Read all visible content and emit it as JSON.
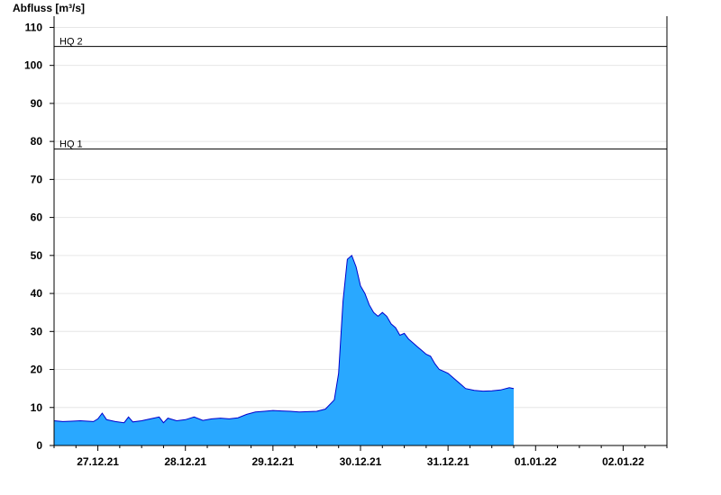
{
  "chart_data": {
    "type": "area",
    "ylabel": "Abfluss [m³/s]",
    "ylim": [
      0,
      112
    ],
    "yticks": [
      0,
      10,
      20,
      30,
      40,
      50,
      60,
      70,
      80,
      90,
      100,
      110
    ],
    "x_range_days": [
      26.5,
      33.5
    ],
    "xticks": [
      {
        "day": 27,
        "label": "27.12.21"
      },
      {
        "day": 28,
        "label": "28.12.21"
      },
      {
        "day": 29,
        "label": "29.12.21"
      },
      {
        "day": 30,
        "label": "30.12.21"
      },
      {
        "day": 31,
        "label": "31.12.21"
      },
      {
        "day": 32,
        "label": "01.01.22"
      },
      {
        "day": 33,
        "label": "02.01.22"
      }
    ],
    "grid": true,
    "thresholds": [
      {
        "name": "HQ 2",
        "value": 105
      },
      {
        "name": "HQ 1",
        "value": 78
      }
    ],
    "colors": {
      "fill": "#29a8ff",
      "line": "#0000cc",
      "grid": "#e6e6e6",
      "threshold": "#000000"
    },
    "series": [
      {
        "x": [
          26.5,
          26.6,
          26.7,
          26.8,
          26.95,
          27.0,
          27.05,
          27.1,
          27.2,
          27.3,
          27.35,
          27.4,
          27.5,
          27.6,
          27.7,
          27.75,
          27.8,
          27.9,
          28.0,
          28.1,
          28.2,
          28.3,
          28.4,
          28.5,
          28.6,
          28.7,
          28.8,
          28.9,
          29.0,
          29.1,
          29.2,
          29.3,
          29.4,
          29.5,
          29.6,
          29.7,
          29.75,
          29.8,
          29.85,
          29.9,
          29.95,
          30.0,
          30.05,
          30.1,
          30.15,
          30.2,
          30.25,
          30.3,
          30.35,
          30.4,
          30.45,
          30.5,
          30.55,
          30.6,
          30.65,
          30.7,
          30.75,
          30.8,
          30.85,
          30.9,
          30.95,
          31.0,
          31.05,
          31.1,
          31.15,
          31.2,
          31.3,
          31.4,
          31.5,
          31.6,
          31.7,
          31.75
        ],
        "y": [
          6.5,
          6.3,
          6.4,
          6.5,
          6.3,
          7.0,
          8.5,
          6.8,
          6.3,
          6.0,
          7.5,
          6.2,
          6.5,
          7.0,
          7.5,
          6.0,
          7.2,
          6.5,
          6.8,
          7.5,
          6.6,
          7.0,
          7.2,
          7.0,
          7.3,
          8.2,
          8.8,
          9.0,
          9.2,
          9.1,
          9.0,
          8.8,
          8.9,
          9.0,
          9.6,
          12.0,
          19.0,
          38.0,
          49.0,
          50.0,
          47.0,
          42.0,
          40.0,
          37.0,
          35.0,
          34.0,
          35.0,
          34.0,
          32.0,
          31.0,
          29.0,
          29.5,
          28.0,
          27.0,
          26.0,
          25.0,
          24.0,
          23.5,
          21.5,
          20.0,
          19.5,
          19.0,
          18.0,
          17.0,
          16.0,
          15.0,
          14.5,
          14.3,
          14.4,
          14.6,
          15.2,
          15.0
        ]
      }
    ]
  }
}
